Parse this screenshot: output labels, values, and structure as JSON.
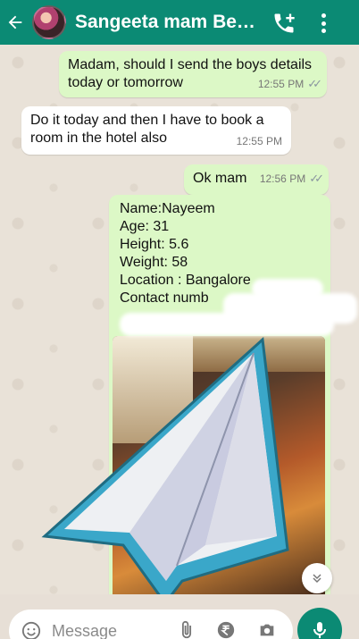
{
  "header": {
    "title": "Sangeeta mam Bengal...",
    "icons": [
      "back-arrow-icon",
      "avatar",
      "add-call-icon",
      "more-vert-icon"
    ]
  },
  "messages": [
    {
      "direction": "outgoing",
      "text": "Madam, should I send the boys details today or tomorrow",
      "time": "12:55 PM",
      "status": "read"
    },
    {
      "direction": "incoming",
      "text": "Do it today and then I have to book a room in the hotel also",
      "time": "12:55 PM"
    },
    {
      "direction": "outgoing",
      "text": "Ok mam",
      "time": "12:56 PM",
      "status": "read"
    },
    {
      "direction": "outgoing",
      "details": [
        "Name:Nayeem",
        " Age: 31",
        " Height: 5.6",
        " Weight: 58",
        " Location : Bangalore",
        " Contact numb"
      ],
      "has_photo": true
    }
  ],
  "input": {
    "placeholder": "Message"
  },
  "colors": {
    "header": "#0b8a74",
    "outgoing_bubble": "#dcf8c6",
    "incoming_bubble": "#ffffff",
    "plane_outline": "#3aa7c9"
  }
}
